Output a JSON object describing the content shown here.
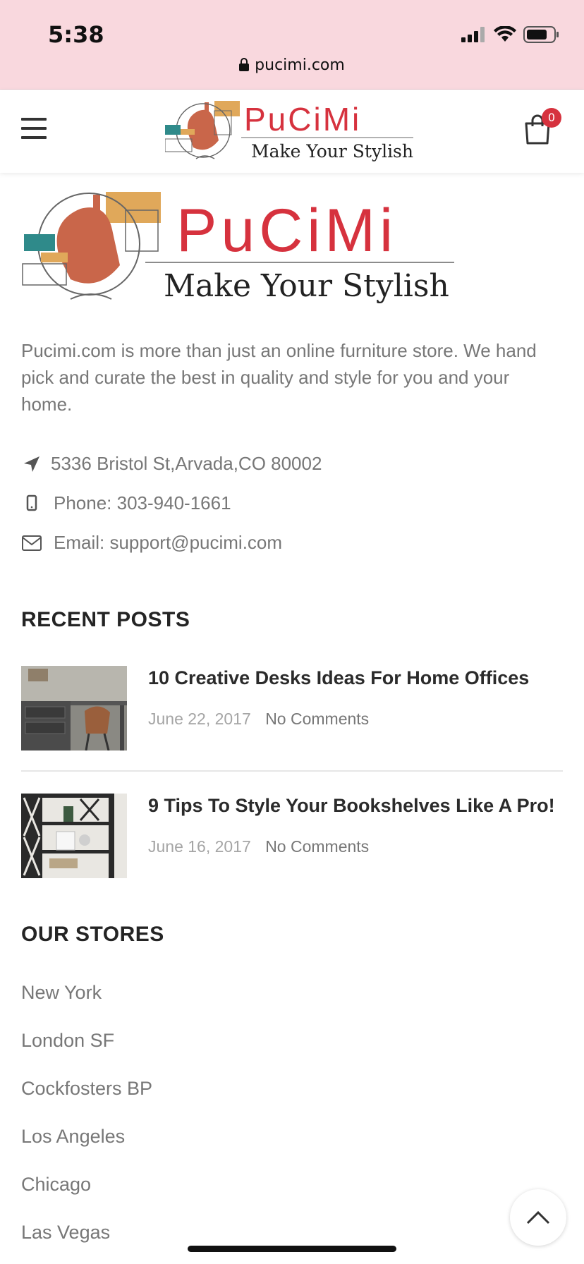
{
  "status_bar": {
    "time": "5:38",
    "url": "pucimi.com",
    "icons": [
      "signal-icon",
      "wifi-icon",
      "battery-icon"
    ]
  },
  "header": {
    "menu_icon": "hamburger-icon",
    "cart_count": "0",
    "logo": {
      "brand": "PuCiMi",
      "tagline": "Make Your Stylish"
    }
  },
  "footer_logo": {
    "brand": "PuCiMi",
    "tagline": "Make Your Stylish"
  },
  "about_text": "Pucimi.com is more than just an online furniture store. We hand pick and curate the best in quality and style for you and your home.",
  "contact": {
    "address": "5336 Bristol St,Arvada,CO 80002",
    "phone": "Phone: 303-940-1661",
    "email": "Email: support@pucimi.com"
  },
  "recent_posts": {
    "title": "RECENT POSTS",
    "items": [
      {
        "title": "10 Creative Desks Ideas For Home Offices",
        "date": "June 22, 2017",
        "comments": "No Comments"
      },
      {
        "title": "9 Tips To Style Your Bookshelves Like A Pro!",
        "date": "June 16, 2017",
        "comments": "No Comments"
      }
    ]
  },
  "stores": {
    "title": "OUR STORES",
    "items": [
      "New York",
      "London SF",
      "Cockfosters BP",
      "Los Angeles",
      "Chicago",
      "Las Vegas"
    ]
  },
  "colors": {
    "status_bar_bg": "#f9d8de",
    "brand_red": "#d6323e",
    "text_gray": "#777777",
    "heading": "#242424"
  }
}
